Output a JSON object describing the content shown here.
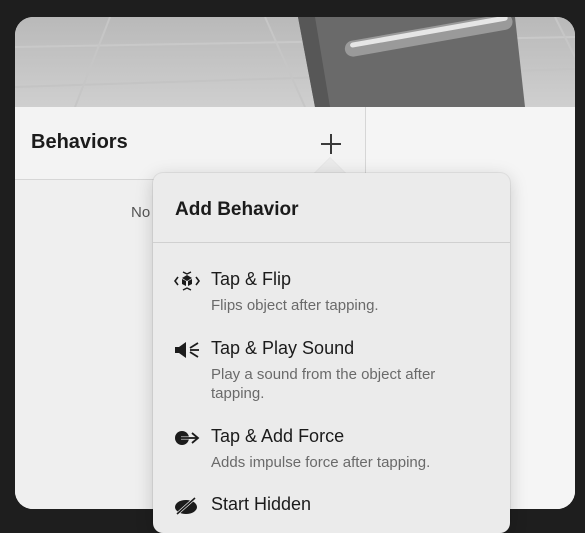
{
  "behaviors": {
    "title": "Behaviors",
    "empty_text": "No"
  },
  "popover": {
    "title": "Add Behavior",
    "items": [
      {
        "name": "Tap & Flip",
        "description": "Flips object after tapping.",
        "icon": "tap-flip-icon"
      },
      {
        "name": "Tap & Play Sound",
        "description": "Play a sound from the object after tapping.",
        "icon": "sound-icon"
      },
      {
        "name": "Tap & Add Force",
        "description": "Adds impulse force after tapping.",
        "icon": "add-force-icon"
      },
      {
        "name": "Start Hidden",
        "description": "",
        "icon": "hidden-icon"
      }
    ]
  }
}
